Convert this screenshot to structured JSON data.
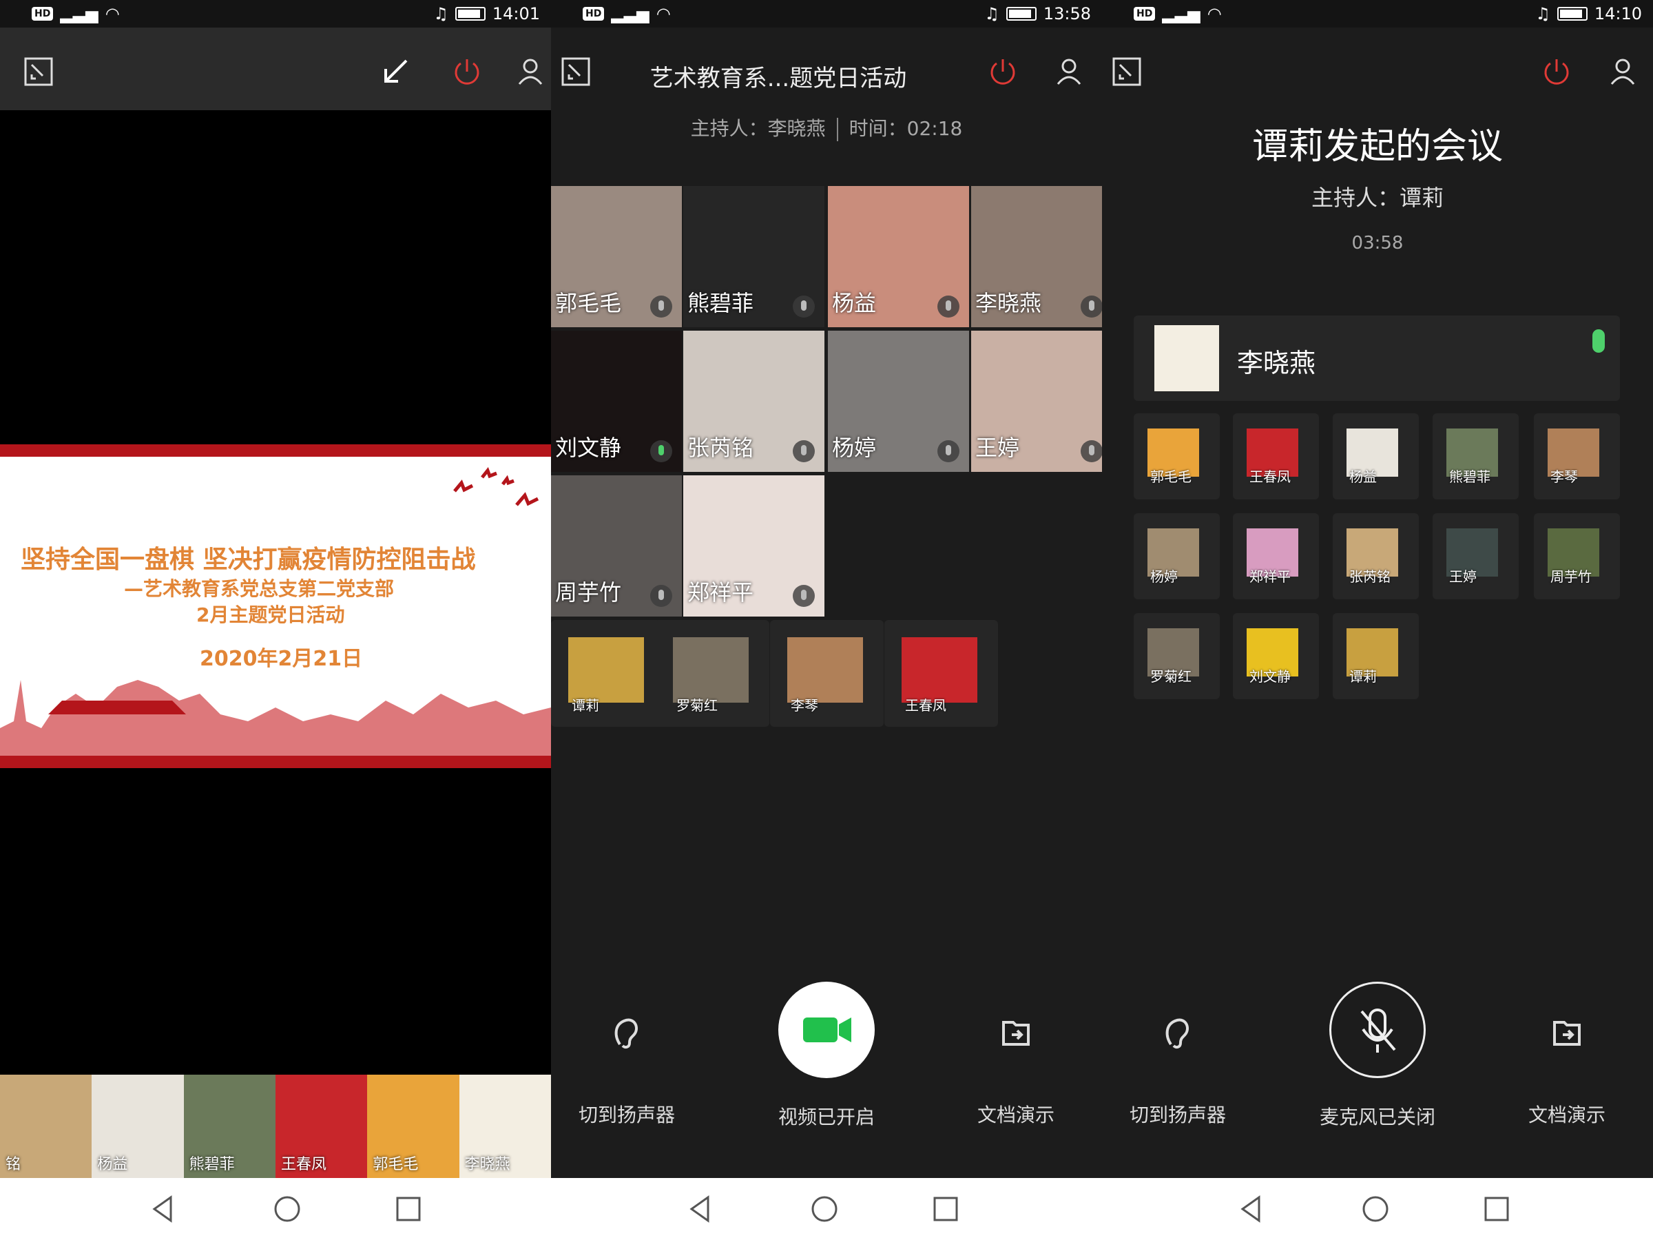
{
  "panels": [
    {
      "status_time": "14:01",
      "slide": {
        "line1": "坚持全国一盘棋 坚决打赢疫情防控阻击战",
        "line2": "—艺术教育系党总支第二党支部",
        "line3": "2月主题党日活动",
        "date": "2020年2月21日"
      },
      "filmstrip": [
        "铭",
        "杨益",
        "熊碧菲",
        "王春凤",
        "郭毛毛",
        "李晓燕"
      ]
    },
    {
      "status_time": "13:58",
      "title": "艺术教育系...题党日活动",
      "host_info": "主持人：李晓燕",
      "time_info": "时间：02:18",
      "video_tiles": [
        "郭毛毛",
        "熊碧菲",
        "杨益",
        "李晓燕",
        "刘文静",
        "张芮铭",
        "杨婷",
        "王婷",
        "周芋竹",
        "郑祥平"
      ],
      "audio_thumbs": [
        "谭莉",
        "罗菊红",
        "李琴",
        "王春凤"
      ],
      "controls": [
        "切到扬声器",
        "视频已开启",
        "文档演示"
      ]
    },
    {
      "status_time": "14:10",
      "title": "谭莉发起的会议",
      "host": "主持人：谭莉",
      "elapsed": "03:58",
      "speaker": "李晓燕",
      "thumbs": [
        "郭毛毛",
        "王春凤",
        "杨益",
        "熊碧菲",
        "李琴",
        "杨婷",
        "郑祥平",
        "张芮铭",
        "王婷",
        "周芋竹",
        "罗菊红",
        "刘文静",
        "谭莉"
      ],
      "controls": [
        "切到扬声器",
        "麦克风已关闭",
        "文档演示"
      ]
    }
  ],
  "colors": {
    "accent_red": "#e03a36",
    "video_green": "#21c04c",
    "slide_red": "#b4151b"
  }
}
